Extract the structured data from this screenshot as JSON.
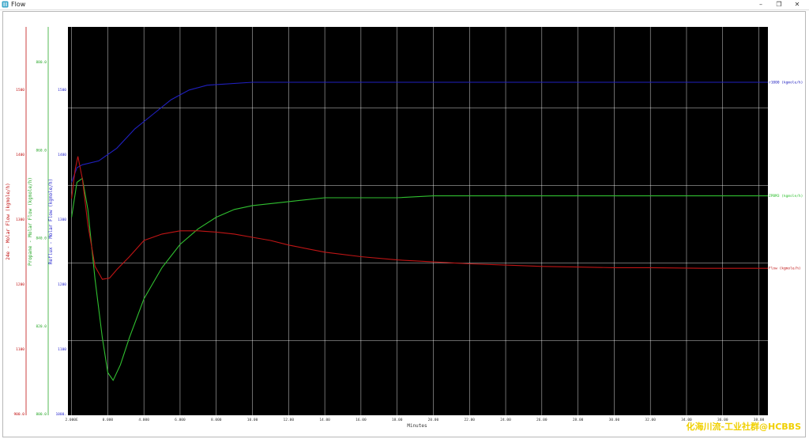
{
  "window": {
    "title": "Flow",
    "icon": "flow-app-icon",
    "controls": [
      "minimize",
      "maximize",
      "close"
    ]
  },
  "watermark": "化海川流-工业社群@HCBBS",
  "chart_data": {
    "type": "line",
    "xlabel": "Minutes",
    "x_ticks": [
      "2.000E",
      "0.000",
      "4.000",
      "6.000",
      "8.000",
      "10.00",
      "12.00",
      "14.00",
      "16.00",
      "18.00",
      "20.00",
      "22.00",
      "24.00",
      "26.00",
      "28.00",
      "30.00",
      "32.00",
      "34.00",
      "36.00",
      "38.00"
    ],
    "x_range": [
      -0.2,
      38.5
    ],
    "background": "#000000",
    "grid": true,
    "grid_color": "#ffffff",
    "legend_placement": "right, at line ends",
    "axes": [
      {
        "id": "blue",
        "label": "Reflux - Molar Flow (kgmole/h)",
        "color": "#2b2bd0",
        "ticks": [
          "1500",
          "1400",
          "1300",
          "1200",
          "1100",
          "1000."
        ],
        "range": [
          1000,
          1400
        ]
      },
      {
        "id": "green",
        "label": "Propane - Molar Flow (kgmole/h)",
        "color": "#2aa82a",
        "ticks": [
          "880.0",
          "860.0",
          "840.0",
          "820.0",
          "800.0"
        ],
        "range": [
          800,
          900
        ]
      },
      {
        "id": "red",
        "label": "24e - Molar Flow (kgmole/h)",
        "color": "#c01010",
        "ticks": [
          "1500",
          "1400",
          "1300",
          "1200",
          "1100",
          "900.0"
        ],
        "range": [
          900,
          1500
        ]
      }
    ],
    "series": [
      {
        "name": "r1000 (kgmole/h)",
        "axis": "blue",
        "color": "#2020c0",
        "x": [
          0,
          0.3,
          0.6,
          1.5,
          2.5,
          3.5,
          4.5,
          5.5,
          6.5,
          7.5,
          10,
          15,
          20,
          25,
          30,
          35,
          38.5
        ],
        "y": [
          1240,
          1255,
          1258,
          1262,
          1275,
          1295,
          1310,
          1325,
          1335,
          1340,
          1343,
          1343,
          1343,
          1343,
          1343,
          1343,
          1343
        ]
      },
      {
        "name": "ZPBM3 (kgmole/h)",
        "axis": "green",
        "color": "#30c030",
        "x": [
          0,
          0.3,
          0.6,
          0.9,
          1.3,
          1.7,
          2.0,
          2.3,
          2.7,
          3.2,
          4,
          5,
          6,
          7,
          8,
          9,
          10,
          12,
          14,
          16,
          18,
          20,
          22,
          26,
          30,
          35,
          38.5
        ],
        "y": [
          851,
          860,
          861,
          853,
          835,
          820,
          811,
          809,
          813,
          820,
          830,
          838,
          844,
          848,
          851,
          853,
          854,
          855,
          856,
          856,
          856,
          856.5,
          856.5,
          856.5,
          856.5,
          856.5,
          856.5
        ]
      },
      {
        "name": "Flow (kgmole/h)",
        "axis": "red",
        "color": "#c01515",
        "x": [
          0,
          0.2,
          0.35,
          0.6,
          0.9,
          1.3,
          1.7,
          2.1,
          2.5,
          3.2,
          4,
          5,
          6,
          7,
          8,
          9,
          10,
          11,
          12,
          14,
          16,
          18,
          20,
          22,
          24,
          26,
          28,
          30,
          32,
          35,
          38.5
        ],
        "y": [
          1235,
          1280,
          1300,
          1265,
          1195,
          1130,
          1110,
          1112,
          1125,
          1145,
          1170,
          1180,
          1185,
          1185,
          1183,
          1180,
          1175,
          1170,
          1163,
          1152,
          1145,
          1140,
          1137,
          1134,
          1132,
          1130,
          1129,
          1128,
          1128,
          1127,
          1127
        ]
      }
    ]
  }
}
